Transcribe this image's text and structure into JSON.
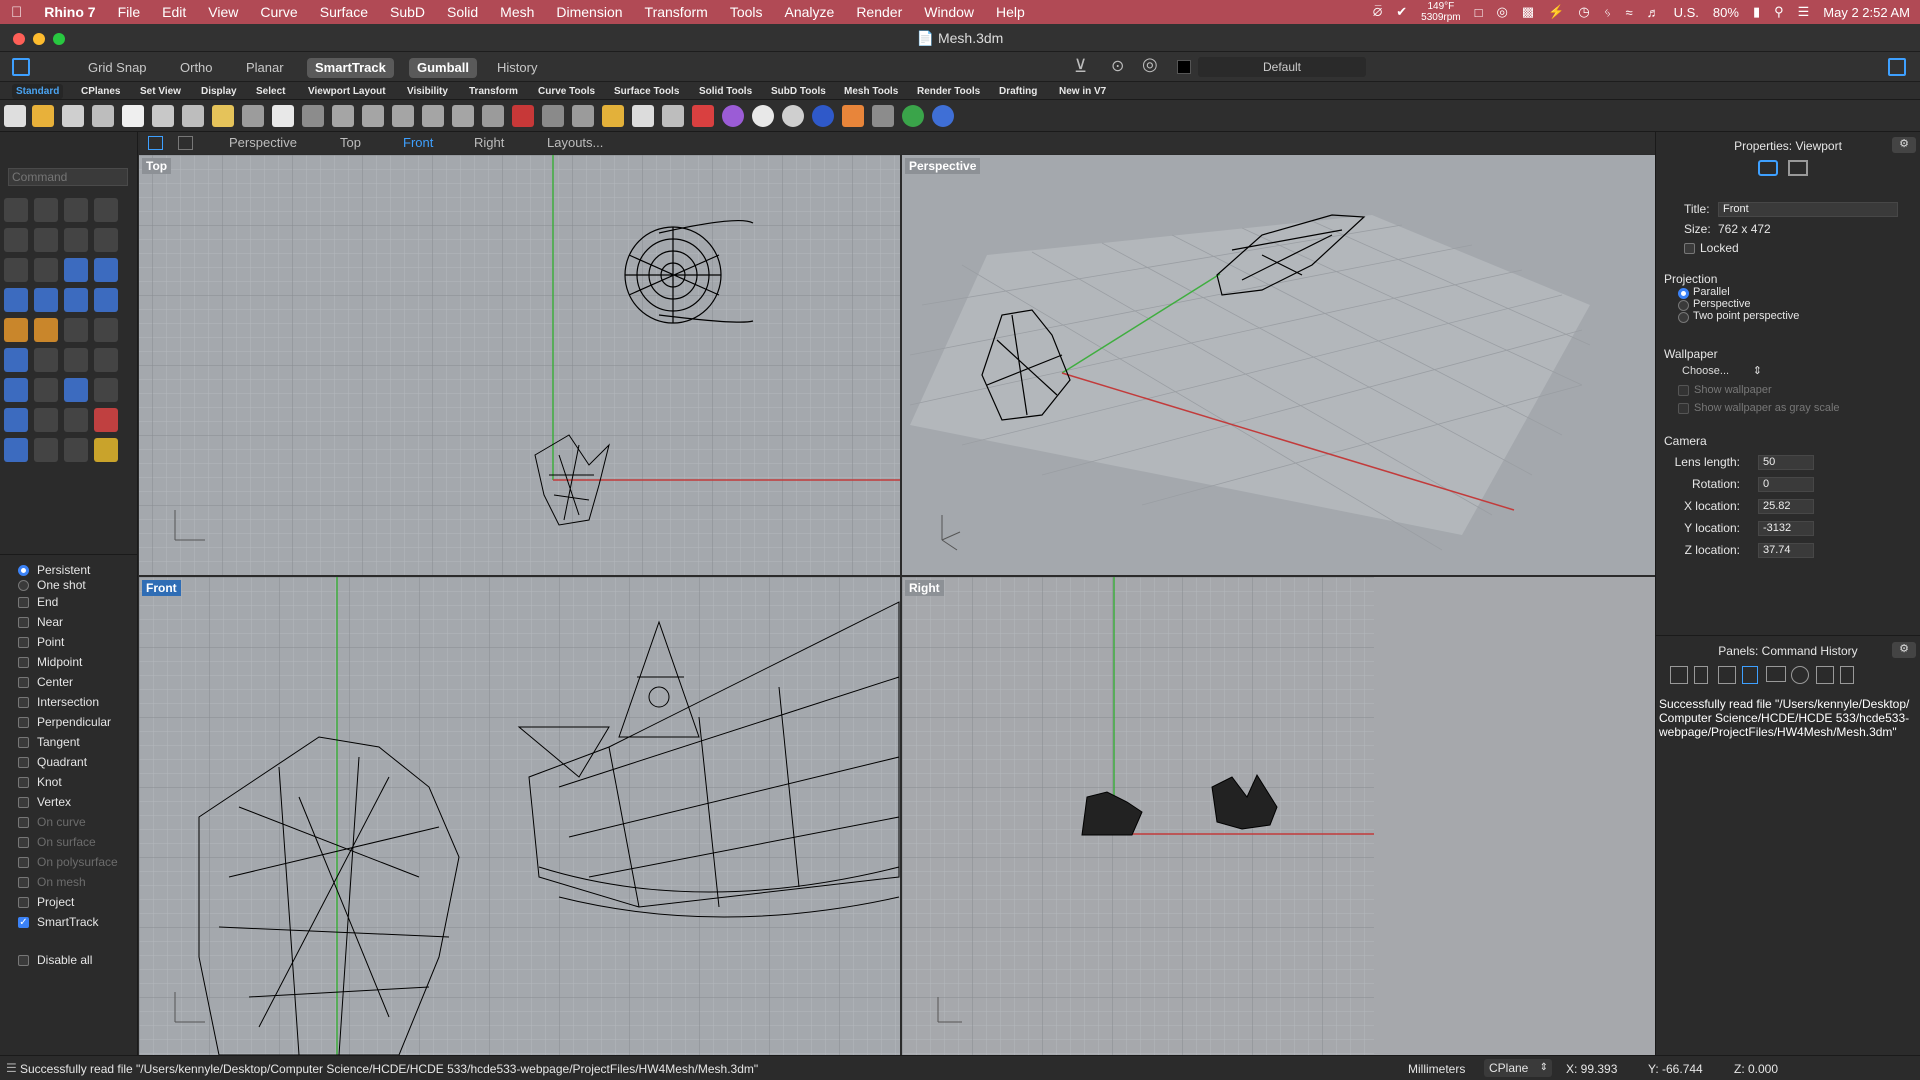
{
  "menubar": {
    "app_name": "Rhino 7",
    "items": [
      "File",
      "Edit",
      "View",
      "Curve",
      "Surface",
      "SubD",
      "Solid",
      "Mesh",
      "Dimension",
      "Transform",
      "Tools",
      "Analyze",
      "Render",
      "Window",
      "Help"
    ],
    "weather_temp": "149°F",
    "weather_rpm": "5309rpm",
    "input_source": "U.S.",
    "battery": "80%",
    "datetime": "May 2  2:52 AM"
  },
  "window": {
    "title": "Mesh.3dm"
  },
  "modes": {
    "items": [
      {
        "label": "Grid Snap",
        "active": false
      },
      {
        "label": "Ortho",
        "active": false
      },
      {
        "label": "Planar",
        "active": false
      },
      {
        "label": "SmartTrack",
        "active": true
      },
      {
        "label": "Gumball",
        "active": true
      },
      {
        "label": "History",
        "active": false
      }
    ],
    "layer": "Default"
  },
  "toolbar_tabs": [
    "Standard",
    "CPlanes",
    "Set View",
    "Display",
    "Select",
    "Viewport Layout",
    "Visibility",
    "Transform",
    "Curve Tools",
    "Surface Tools",
    "Solid Tools",
    "SubD Tools",
    "Mesh Tools",
    "Render Tools",
    "Drafting",
    "New in V7"
  ],
  "viewport_tabs": {
    "items": [
      "Perspective",
      "Top",
      "Front",
      "Right",
      "Layouts..."
    ],
    "active": "Front"
  },
  "command": {
    "placeholder": "Command"
  },
  "osnaps": {
    "persistent": "Persistent",
    "one_shot": "One shot",
    "items": [
      {
        "label": "End",
        "checked": false,
        "enabled": true
      },
      {
        "label": "Near",
        "checked": false,
        "enabled": true
      },
      {
        "label": "Point",
        "checked": false,
        "enabled": true
      },
      {
        "label": "Midpoint",
        "checked": false,
        "enabled": true
      },
      {
        "label": "Center",
        "checked": false,
        "enabled": true
      },
      {
        "label": "Intersection",
        "checked": false,
        "enabled": true
      },
      {
        "label": "Perpendicular",
        "checked": false,
        "enabled": true
      },
      {
        "label": "Tangent",
        "checked": false,
        "enabled": true
      },
      {
        "label": "Quadrant",
        "checked": false,
        "enabled": true
      },
      {
        "label": "Knot",
        "checked": false,
        "enabled": true
      },
      {
        "label": "Vertex",
        "checked": false,
        "enabled": true
      },
      {
        "label": "On curve",
        "checked": false,
        "enabled": false
      },
      {
        "label": "On surface",
        "checked": false,
        "enabled": false
      },
      {
        "label": "On polysurface",
        "checked": false,
        "enabled": false
      },
      {
        "label": "On mesh",
        "checked": false,
        "enabled": false
      },
      {
        "label": "Project",
        "checked": false,
        "enabled": true
      },
      {
        "label": "SmartTrack",
        "checked": true,
        "enabled": true
      }
    ],
    "disable_all": "Disable all"
  },
  "viewports": {
    "top": "Top",
    "perspective": "Perspective",
    "front": "Front",
    "right": "Right"
  },
  "properties": {
    "header": "Properties: Viewport",
    "title_label": "Title:",
    "title_value": "Front",
    "size_label": "Size:",
    "size_value": "762 x 472",
    "locked": "Locked",
    "projection": "Projection",
    "parallel": "Parallel",
    "perspective": "Perspective",
    "two_point": "Two point perspective",
    "wallpaper": "Wallpaper",
    "choose": "Choose...",
    "show_wallpaper": "Show wallpaper",
    "show_gray": "Show wallpaper as gray scale",
    "camera": "Camera",
    "lens_label": "Lens length:",
    "lens": "50",
    "rotation_label": "Rotation:",
    "rotation": "0",
    "xloc_label": "X location:",
    "xloc": "25.82",
    "yloc_label": "Y location:",
    "yloc": "-3132",
    "zloc_label": "Z location:",
    "zloc": "37.74"
  },
  "panels": {
    "header": "Panels: Command History",
    "history": "Successfully read file \"/Users/kennyle/Desktop/Computer Science/HCDE/HCDE 533/hcde533-webpage/ProjectFiles/HW4Mesh/Mesh.3dm\""
  },
  "status": {
    "message": "Successfully read file \"/Users/kennyle/Desktop/Computer Science/HCDE/HCDE 533/hcde533-webpage/ProjectFiles/HW4Mesh/Mesh.3dm\"",
    "units": "Millimeters",
    "cplane": "CPlane",
    "x": "X: 99.393",
    "y": "Y: -66.744",
    "z": "Z: 0.000"
  },
  "colors": {
    "menubar": "#b14a55",
    "accent": "#3ea0ff",
    "viewport_bg": "#a4a8ad",
    "x_axis": "#c23b3b",
    "y_axis": "#3fae3f"
  }
}
